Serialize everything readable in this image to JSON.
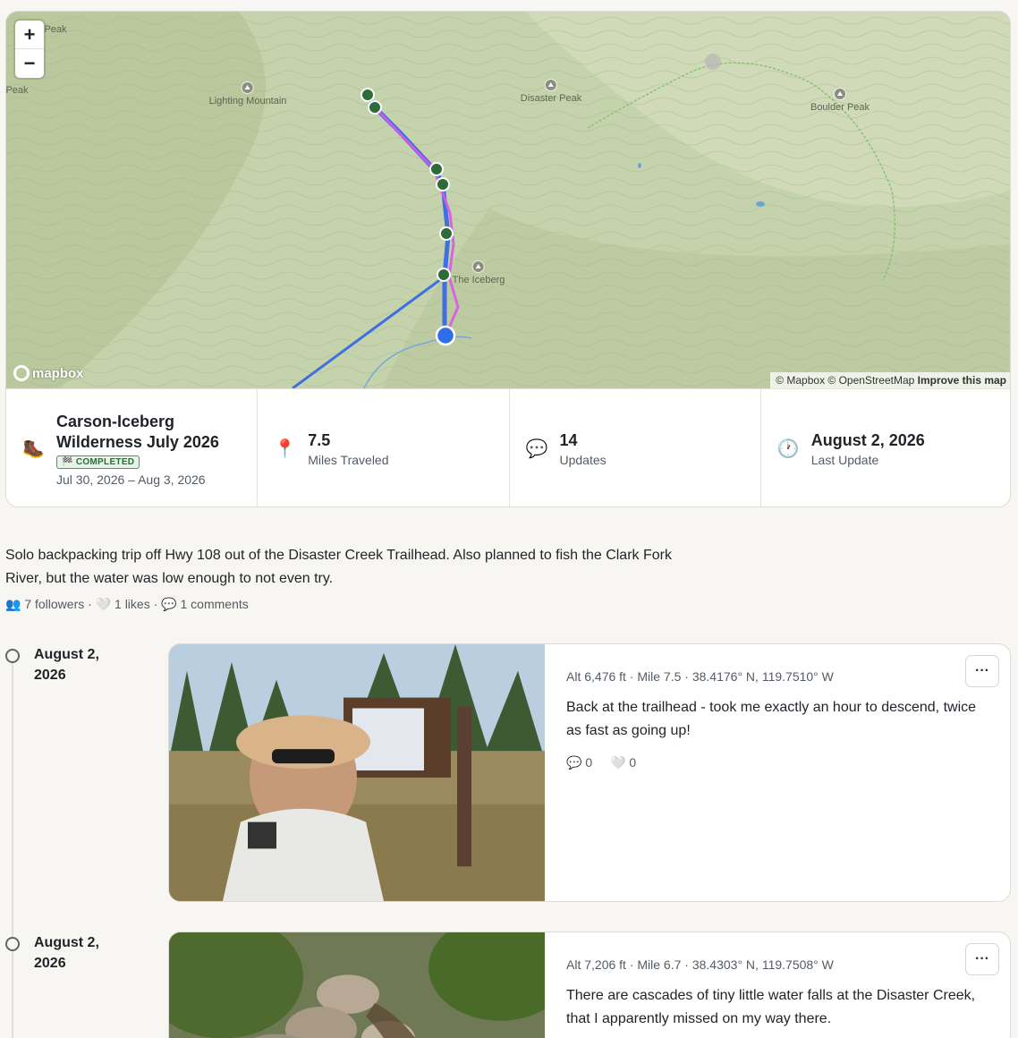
{
  "map": {
    "zoom_in": "+",
    "zoom_out": "−",
    "peaks": [
      "Peak",
      "Lighting Mountain",
      "Disaster Peak",
      "Boulder Peak",
      "The Iceberg"
    ],
    "peak_partial": "Peak",
    "logo": "mapbox",
    "attribution": "© Mapbox © OpenStreetMap",
    "improve": "Improve this map",
    "colors": {
      "track": "#3f6fe0",
      "track_alt": "#d95ae6",
      "waypoint": "#2f6b3a",
      "current": "#2f6ee8"
    }
  },
  "trip": {
    "icon": "boot-icon",
    "title": "Carson-Iceberg Wilderness July 2026",
    "badge": "🏁 COMPLETED",
    "dates": "Jul 30, 2026 – Aug 3, 2026"
  },
  "stats": [
    {
      "icon": "📍",
      "value": "7.5",
      "label": "Miles Traveled"
    },
    {
      "icon": "💬",
      "value": "14",
      "label": "Updates"
    },
    {
      "icon": "🕐",
      "value": "August 2, 2026",
      "label": "Last Update"
    }
  ],
  "description": "Solo backpacking trip off Hwy 108 out of the Disaster Creek Trailhead. Also planned to fish the Clark Fork River, but the water was low enough to not even try.",
  "meta": {
    "followers": "👥 7 followers",
    "likes": "🤍 1 likes",
    "comments": "💬 1 comments",
    "sep": "·"
  },
  "posts": [
    {
      "date": "August 2, 2026",
      "location": "Alt 6,476 ft · Mile 7.5 · 38.4176° N, 119.7510° W",
      "text": "Back at the trailhead - took me exactly an hour to descend, twice as fast as going up!",
      "comments": "💬 0",
      "likes": "🤍 0",
      "more": "···"
    },
    {
      "date": "August 2, 2026",
      "location": "Alt 7,206 ft · Mile 6.7 · 38.4303° N, 119.7508° W",
      "text": "There are cascades of tiny little water falls at the Disaster Creek, that I apparently missed on my way there.",
      "more": "···"
    }
  ]
}
